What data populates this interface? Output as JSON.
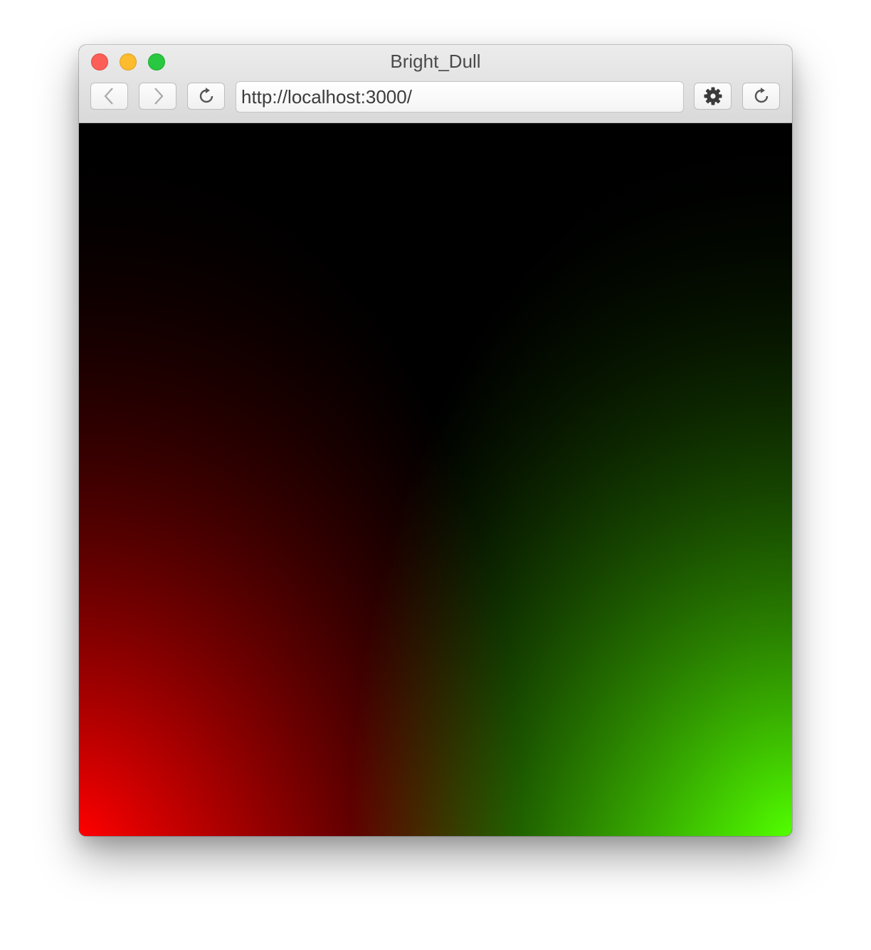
{
  "window": {
    "title": "Bright_Dull"
  },
  "toolbar": {
    "back_icon": "chevron-left-icon",
    "forward_icon": "chevron-right-icon",
    "reload_icon": "reload-icon",
    "settings_icon": "gear-icon",
    "reload2_icon": "reload-icon"
  },
  "address_bar": {
    "url": "http://localhost:3000/"
  },
  "canvas": {
    "bottom_left_color": "#ff0000",
    "bottom_center_color": "#ffff00",
    "bottom_right_color": "#52ff00",
    "top_color": "#000000"
  }
}
